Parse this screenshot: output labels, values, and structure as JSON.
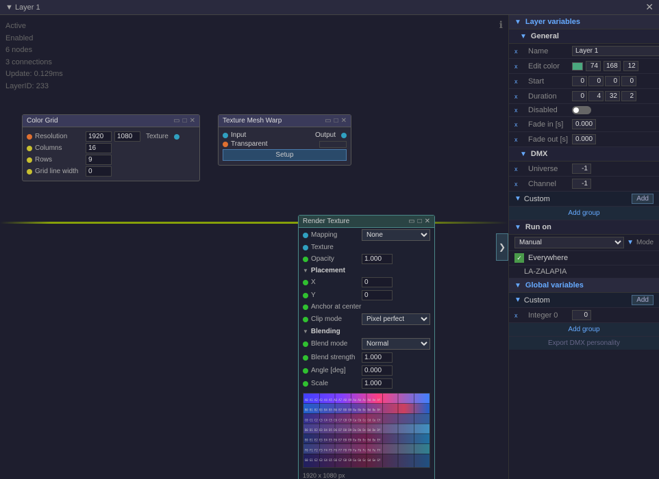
{
  "titleBar": {
    "label": "▼ Layer 1",
    "closeIcon": "✕"
  },
  "status": {
    "active": "Active",
    "enabled": "Enabled",
    "nodes": "6 nodes",
    "connections": "3 connections",
    "update": "Update: 0.129ms",
    "layerId": "LayerID: 233"
  },
  "nodeColorGrid": {
    "title": "Color Grid",
    "resolution_w": "1920",
    "resolution_h": "1080",
    "columns": "16",
    "rows": "9",
    "gridLineWidth": "0",
    "textureLabel": "Texture"
  },
  "nodeTMW": {
    "title": "Texture Mesh Warp",
    "inputLabel": "Input",
    "outputLabel": "Output",
    "transparentLabel": "Transparent",
    "setupBtn": "Setup"
  },
  "renderTexture": {
    "title": "Render Texture",
    "mappingLabel": "Mapping",
    "mappingValue": "None",
    "textureLabel": "Texture",
    "opacityLabel": "Opacity",
    "opacityValue": "1.000",
    "placementSection": "Placement",
    "xLabel": "X",
    "xValue": "0",
    "yLabel": "Y",
    "yValue": "0",
    "anchorLabel": "Anchor at center",
    "clipModeLabel": "Clip mode",
    "clipModeValue": "Pixel perfect",
    "blendingSection": "Blending",
    "blendModeLabel": "Blend mode",
    "blendModeValue": "Normal",
    "blendStrengthLabel": "Blend strength",
    "blendStrengthValue": "1.000",
    "angleLabel": "Angle [deg]",
    "angleValue": "0.000",
    "scaleLabel": "Scale",
    "scaleValue": "1.000",
    "previewSize": "1920 x 1080 px"
  },
  "rightPanel": {
    "layerVarsTitle": "Layer variables",
    "generalTitle": "General",
    "nameLabel": "Name",
    "nameValue": "Layer 1",
    "editColorLabel": "Edit color",
    "editColorR": "74",
    "editColorG": "168",
    "editColorB": "12",
    "startLabel": "Start",
    "startVals": [
      "0",
      "0",
      "0",
      "0"
    ],
    "durationLabel": "Duration",
    "durationVals": [
      "0",
      "4",
      "32",
      "2"
    ],
    "disabledLabel": "Disabled",
    "fadeInLabel": "Fade in [s]",
    "fadeInValue": "0.000",
    "fadeOutLabel": "Fade out [s]",
    "fadeOutValue": "0.000",
    "dmxTitle": "DMX",
    "universeLabel": "Universe",
    "universeValue": "-1",
    "channelLabel": "Channel",
    "channelValue": "-1",
    "customLabel": "Custom",
    "addLabel": "Add",
    "addGroupLabel": "Add group",
    "runOnTitle": "Run on",
    "manualLabel": "Manual",
    "modeLabel": "Mode",
    "everywhereLabel": "Everywhere",
    "deviceLabel": "LA-ZALAPIA",
    "globalVarsTitle": "Global variables",
    "customLabel2": "Custom",
    "addLabel2": "Add",
    "integerLabel": "Integer 0",
    "integerValue": "0",
    "addGroupLabel2": "Add group",
    "exportLabel": "Export DMX personality"
  },
  "arrowBtn": "❯",
  "infoIcon": "ℹ"
}
